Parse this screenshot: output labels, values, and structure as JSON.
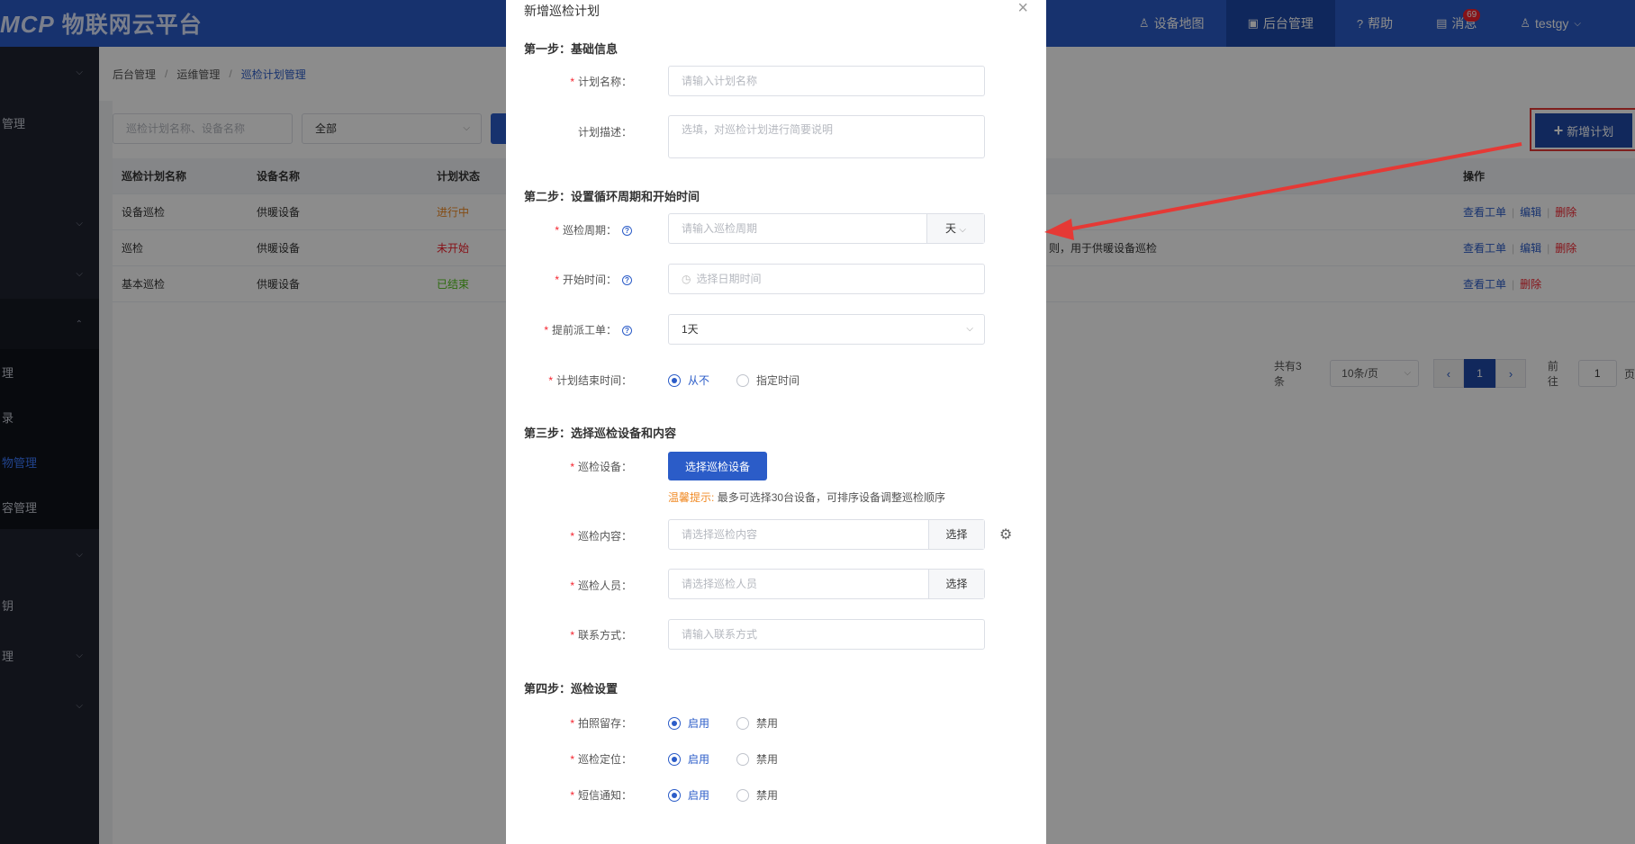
{
  "header": {
    "logo_mark": "MCP",
    "logo_title": "物联网云平台",
    "nav": [
      {
        "icon": "map-pin-icon",
        "glyph": "♙",
        "label": "设备地图"
      },
      {
        "icon": "console-icon",
        "glyph": "▣",
        "label": "后台管理"
      },
      {
        "icon": "help-icon",
        "glyph": "?",
        "label": "帮助"
      },
      {
        "icon": "message-icon",
        "glyph": "▤",
        "label": "消息",
        "badge": "69"
      },
      {
        "icon": "user-icon",
        "glyph": "♙",
        "label": "testgy"
      }
    ]
  },
  "sidebar": {
    "items": [
      {
        "label": "",
        "has_chevron": true
      },
      {
        "label": "管理",
        "has_chevron": false
      },
      {
        "label": "",
        "has_chevron": false
      },
      {
        "label": "",
        "has_chevron": true
      },
      {
        "label": "",
        "has_chevron": true
      },
      {
        "label": "",
        "has_chevron": true
      }
    ],
    "sub_items": [
      {
        "label": "理"
      },
      {
        "label": "录"
      },
      {
        "label": "物管理"
      },
      {
        "label": "容管理"
      }
    ],
    "items_after": [
      {
        "label": "",
        "has_chevron": true
      },
      {
        "label": "钥",
        "has_chevron": false
      },
      {
        "label": "理",
        "has_chevron": true
      },
      {
        "label": "",
        "has_chevron": true
      }
    ]
  },
  "breadcrumb": [
    "后台管理",
    "运维管理",
    "巡检计划管理"
  ],
  "filters": {
    "search_placeholder": "巡检计划名称、设备名称",
    "status_value": "全部"
  },
  "add_button_label": "新增计划",
  "table": {
    "headers": [
      "巡检计划名称",
      "设备名称",
      "计划状态",
      "",
      "操作"
    ],
    "rows": [
      {
        "name": "设备巡检",
        "device": "供暖设备",
        "status": "进行中",
        "status_type": "run",
        "desc": "",
        "ops": [
          "查看工单",
          "编辑",
          "删除"
        ]
      },
      {
        "name": "巡检",
        "device": "供暖设备",
        "status": "未开始",
        "status_type": "wait",
        "desc": "则，用于供暖设备巡检",
        "ops": [
          "查看工单",
          "编辑",
          "删除"
        ]
      },
      {
        "name": "基本巡检",
        "device": "供暖设备",
        "status": "已结束",
        "status_type": "done",
        "desc": "",
        "ops": [
          "查看工单",
          "删除"
        ]
      }
    ]
  },
  "pagination": {
    "total": "共有3条",
    "page_size": "10条/页",
    "current": "1",
    "goto_label": "前往",
    "goto_value": "1",
    "unit": "页"
  },
  "modal": {
    "title": "新增巡检计划",
    "steps": {
      "s1": "第一步：基础信息",
      "s2": "第二步：设置循环周期和开始时间",
      "s3": "第三步：选择巡检设备和内容",
      "s4": "第四步：巡检设置"
    },
    "plan_name": {
      "label": "计划名称：",
      "placeholder": "请输入计划名称"
    },
    "plan_desc": {
      "label": "计划描述：",
      "placeholder": "选填，对巡检计划进行简要说明"
    },
    "cycle": {
      "label": "巡检周期：",
      "placeholder": "请输入巡检周期",
      "unit": "天"
    },
    "start_time": {
      "label": "开始时间：",
      "placeholder": "选择日期时间"
    },
    "advance": {
      "label": "提前派工单：",
      "value": "1天"
    },
    "end_time": {
      "label": "计划结束时间：",
      "options": [
        "从不",
        "指定时间"
      ],
      "selected": 0
    },
    "device": {
      "label": "巡检设备：",
      "button": "选择巡检设备"
    },
    "tip": {
      "warm": "温馨提示:",
      "text": "最多可选择30台设备，可排序设备调整巡检顺序"
    },
    "content": {
      "label": "巡检内容：",
      "placeholder": "请选择巡检内容",
      "button": "选择"
    },
    "staff": {
      "label": "巡检人员：",
      "placeholder": "请选择巡检人员",
      "button": "选择"
    },
    "contact": {
      "label": "联系方式：",
      "placeholder": "请输入联系方式"
    },
    "photo": {
      "label": "拍照留存：",
      "options": [
        "启用",
        "禁用"
      ],
      "selected": 0
    },
    "locate": {
      "label": "巡检定位：",
      "options": [
        "启用",
        "禁用"
      ],
      "selected": 0
    },
    "sms": {
      "label": "短信通知：",
      "options": [
        "启用",
        "禁用"
      ],
      "selected": 0
    }
  },
  "colors": {
    "primary": "#2b5cc8",
    "annotation": "#e53935"
  }
}
